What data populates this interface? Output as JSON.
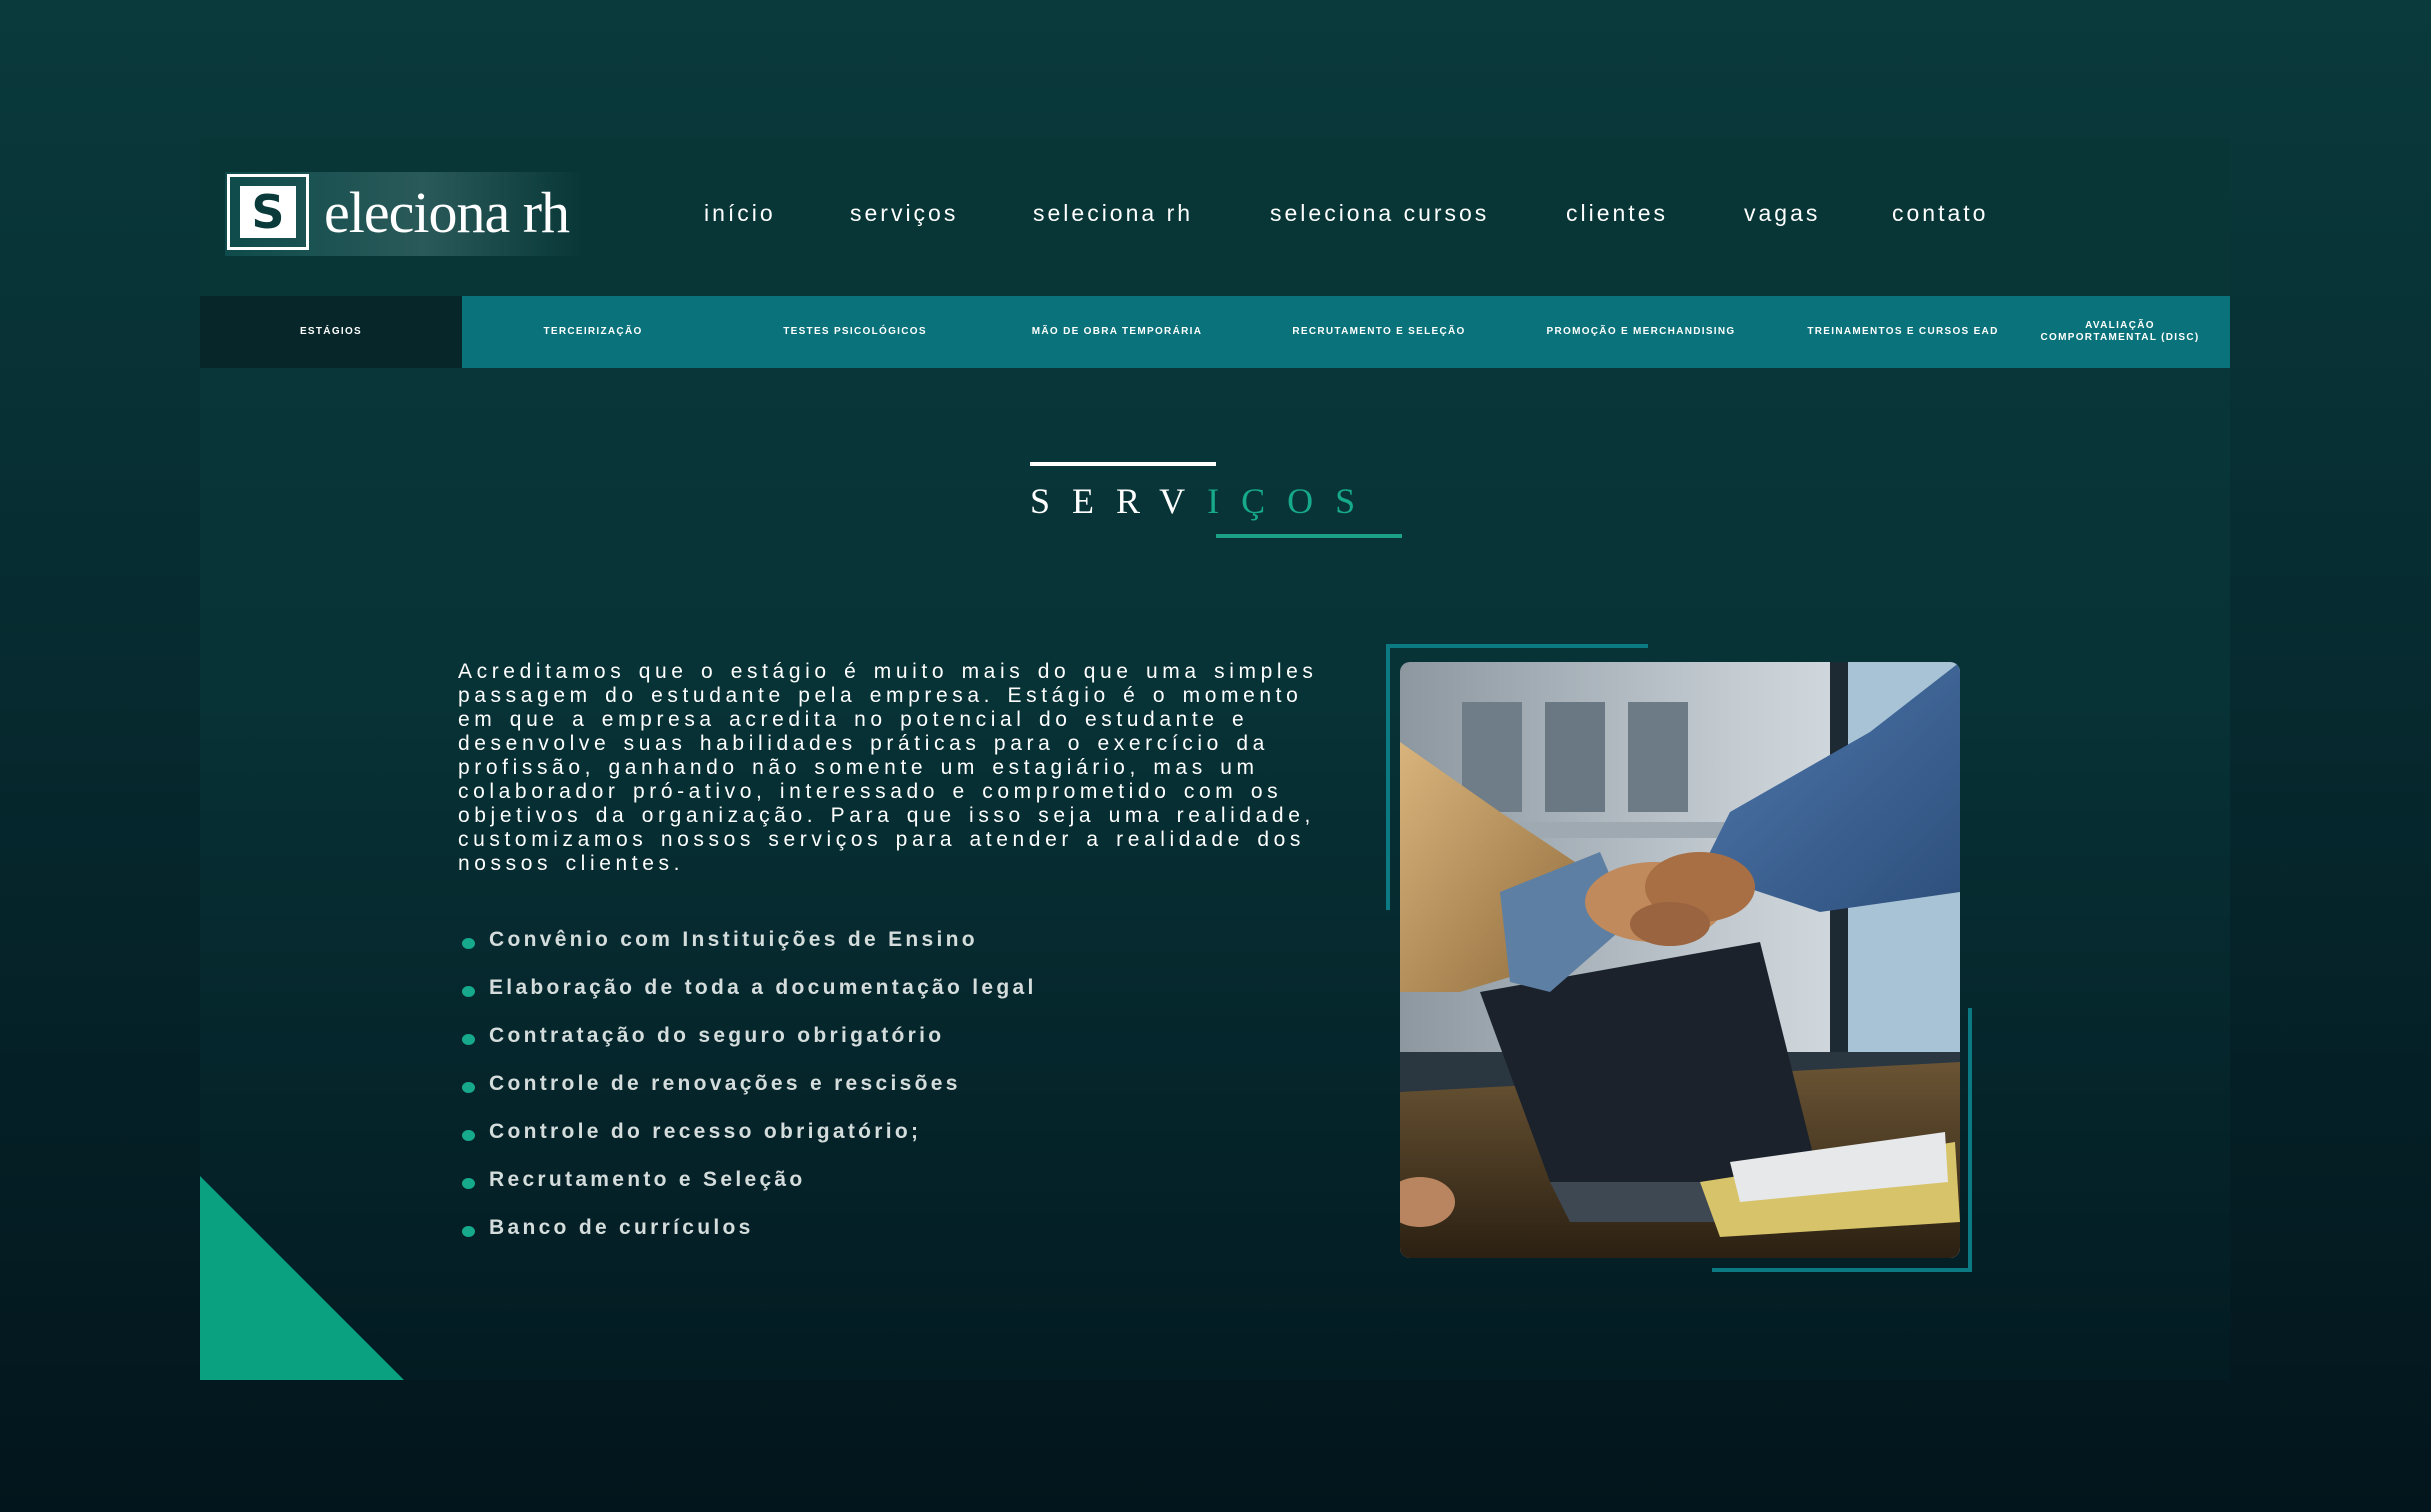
{
  "header": {
    "logo": {
      "letter": "S",
      "text": "eleciona rh"
    },
    "nav": [
      {
        "label": "início"
      },
      {
        "label": "serviços"
      },
      {
        "label": "seleciona rh"
      },
      {
        "label": "seleciona cursos"
      },
      {
        "label": "clientes"
      },
      {
        "label": "vagas"
      },
      {
        "label": "contato"
      }
    ]
  },
  "subnav": [
    {
      "label": "ESTÁGIOS",
      "active": true
    },
    {
      "label": "TERCEIRIZAÇÃO"
    },
    {
      "label": "TESTES PSICOLÓGICOS"
    },
    {
      "label": "MÃO DE OBRA TEMPORÁRIA"
    },
    {
      "label": "RECRUTAMENTO E SELEÇÃO"
    },
    {
      "label": "PROMOÇÃO E MERCHANDISING"
    },
    {
      "label": "TREINAMENTOS E CURSOS EAD"
    },
    {
      "label": "AVALIAÇÃO COMPORTAMENTAL (DISC)"
    }
  ],
  "section": {
    "title_part1": "SERV",
    "title_part2": "IÇOS",
    "paragraph": "Acreditamos que o estágio é muito mais do que uma simples passagem do estudante pela empresa. Estágio é o momento em que a empresa acredita no potencial do estudante e desenvolve suas habilidades práticas para o exercício da profissão, ganhando não somente um estagiário, mas um colaborador pró-ativo, interessado e comprometido com os objetivos da organização. Para que isso seja uma realidade, customizamos nossos serviços para atender a realidade dos nossos clientes.",
    "list": [
      "Convênio com Instituições de Ensino",
      "Elaboração de toda a documentação legal",
      "Contratação do seguro obrigatório",
      "Controle de renovações e rescisões",
      "Controle do recesso obrigatório;",
      "Recrutamento e Seleção",
      "Banco de currículos"
    ]
  },
  "colors": {
    "accent": "#17a98c",
    "subnav": "#0a727a",
    "subnav_active": "#062629",
    "frame_line": "#0b7a82"
  }
}
